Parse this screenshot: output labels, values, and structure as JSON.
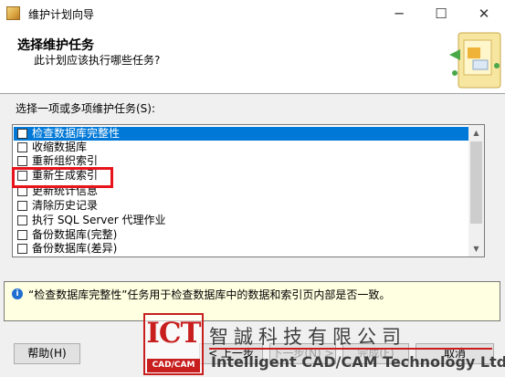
{
  "window": {
    "title": "维护计划向导",
    "minimize_glyph": "─",
    "maximize_glyph": "☐",
    "close_glyph": "✕"
  },
  "header": {
    "title": "选择维护任务",
    "subtitle": "此计划应该执行哪些任务?"
  },
  "tasks": {
    "label": "选择一项或多项维护任务(S):",
    "items": [
      {
        "label": "检查数据库完整性",
        "checked": false,
        "selected": true
      },
      {
        "label": "收缩数据库",
        "checked": false,
        "selected": false
      },
      {
        "label": "重新组织索引",
        "checked": false,
        "selected": false
      },
      {
        "label": "重新生成索引",
        "checked": false,
        "selected": false
      },
      {
        "label": "更新统计信息",
        "checked": false,
        "selected": false
      },
      {
        "label": "清除历史记录",
        "checked": false,
        "selected": false
      },
      {
        "label": "执行 SQL Server 代理作业",
        "checked": false,
        "selected": false
      },
      {
        "label": "备份数据库(完整)",
        "checked": false,
        "selected": false
      },
      {
        "label": "备份数据库(差异)",
        "checked": false,
        "selected": false
      }
    ]
  },
  "description": {
    "text": "“检查数据库完整性”任务用于检查数据库中的数据和索引页内部是否一致。",
    "icon_glyph": "i"
  },
  "buttons": {
    "help": "帮助(H)",
    "back": "< 上一步",
    "next": "下一步(N) >",
    "finish": "完成(F)",
    "cancel": "取消"
  },
  "watermark": {
    "logo_text": "ICT",
    "logo_sub": "CAD/CAM",
    "company_cn": "智誠科技有限公司",
    "company_en": "Intelligent CAD/CAM Technology Ltd."
  },
  "colors": {
    "selection": "#0078d7",
    "highlight_box": "#e8141b",
    "info_panel": "#ffffe1",
    "logo_red": "#c81e1e"
  }
}
